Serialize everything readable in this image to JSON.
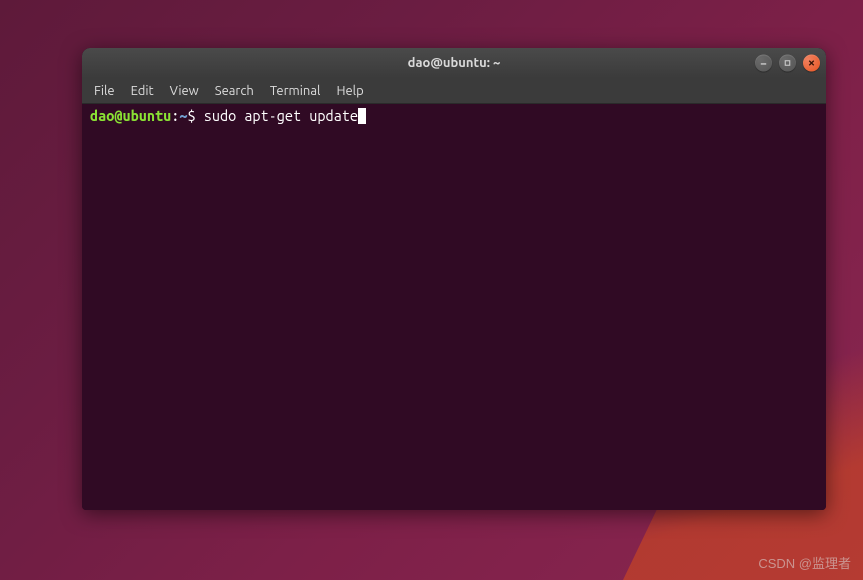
{
  "window": {
    "title": "dao@ubuntu: ~"
  },
  "menubar": {
    "items": [
      "File",
      "Edit",
      "View",
      "Search",
      "Terminal",
      "Help"
    ]
  },
  "prompt": {
    "user_host": "dao@ubuntu",
    "separator": ":",
    "path": "~",
    "symbol": "$ "
  },
  "command": "sudo apt-get update",
  "watermark": "CSDN @监理者"
}
